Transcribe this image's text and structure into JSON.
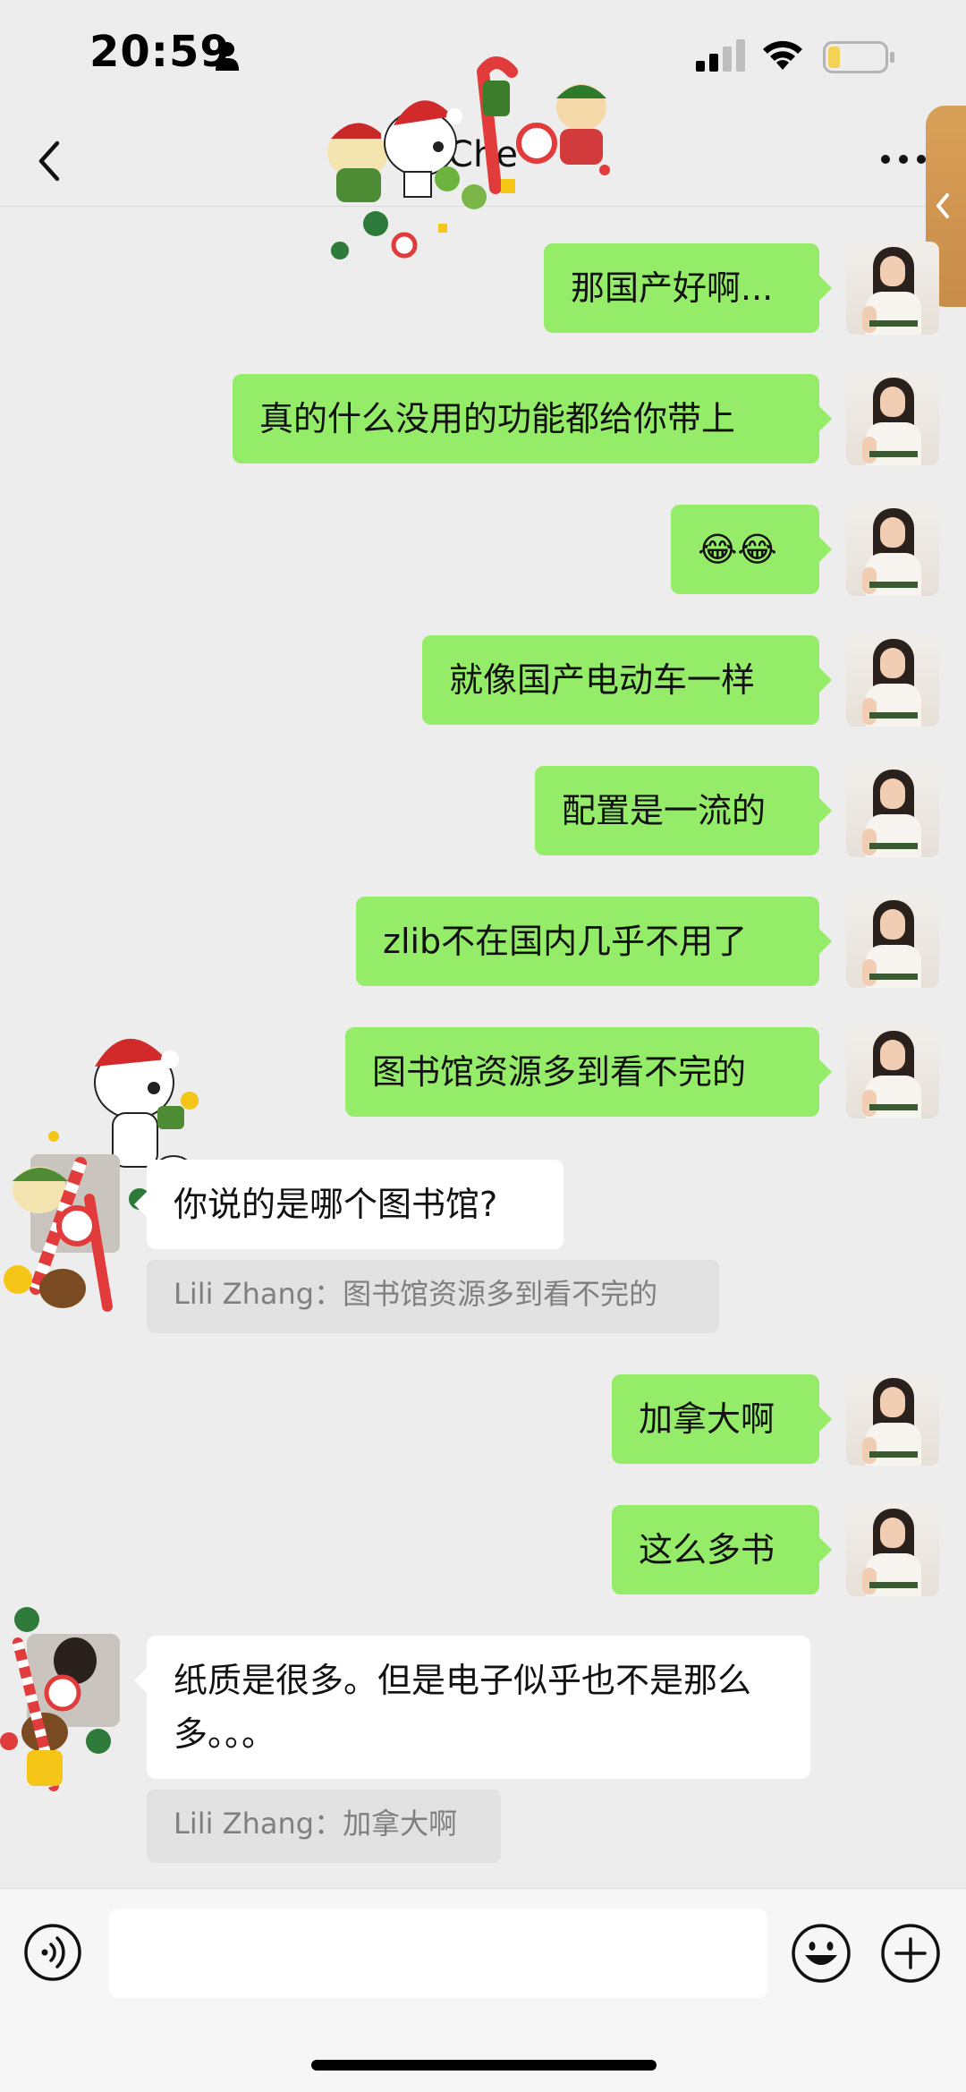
{
  "status_bar": {
    "time": "20:59"
  },
  "header": {
    "title": "Che"
  },
  "messages": [
    {
      "direction": "out",
      "text": "那国产好啊..."
    },
    {
      "direction": "out",
      "text": "真的什么没用的功能都给你带上"
    },
    {
      "direction": "out",
      "text": "😂😂"
    },
    {
      "direction": "out",
      "text": "就像国产电动车一样"
    },
    {
      "direction": "out",
      "text": "配置是一流的"
    },
    {
      "direction": "out",
      "text": "zlib不在国内几乎不用了"
    },
    {
      "direction": "out",
      "text": "图书馆资源多到看不完的"
    },
    {
      "direction": "in",
      "text": "你说的是哪个图书馆?",
      "quote": "Lili Zhang：图书馆资源多到看不完的"
    },
    {
      "direction": "out",
      "text": "加拿大啊"
    },
    {
      "direction": "out",
      "text": "这么多书"
    },
    {
      "direction": "in",
      "text": "纸质是很多。但是电子似乎也不是那么多。。。",
      "quote": "Lili Zhang：加拿大啊"
    }
  ],
  "input": {
    "value": ""
  },
  "icons": {
    "back": "chevron-left-icon",
    "more": "more-dots-icon",
    "voice": "voice-icon",
    "emoji": "emoji-icon",
    "plus": "plus-icon"
  },
  "colors": {
    "out_bubble": "#95ec69",
    "in_bubble": "#ffffff",
    "background": "#ededed",
    "quote_bg": "#e2e2e2"
  }
}
